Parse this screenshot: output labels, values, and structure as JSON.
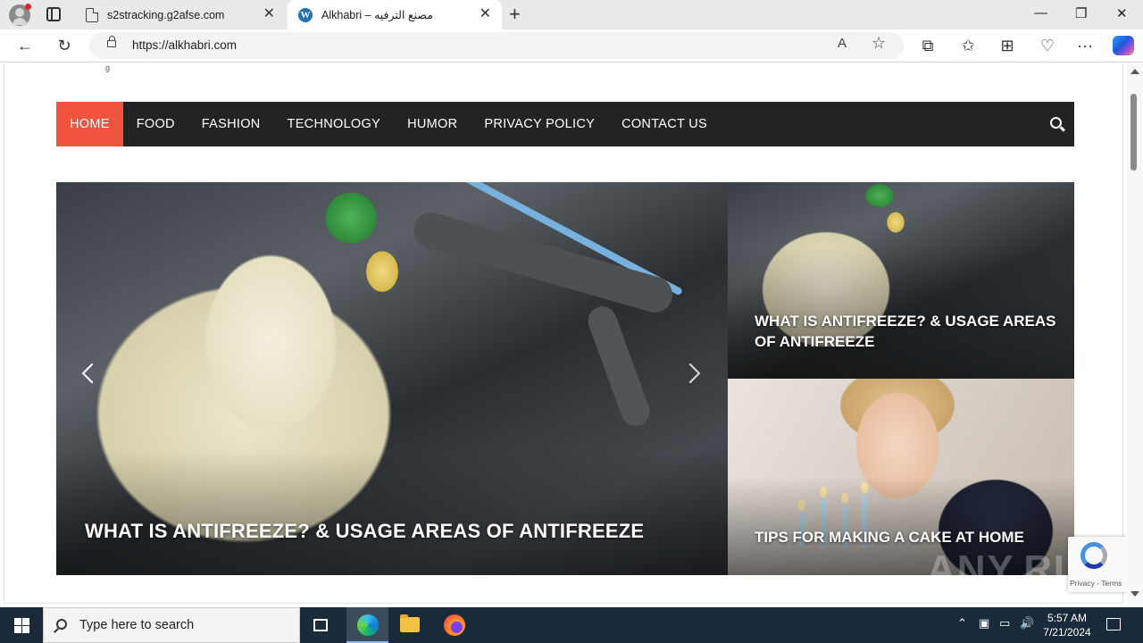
{
  "browser": {
    "tabs": [
      {
        "title": "s2stracking.g2afse.com",
        "close": "✕"
      },
      {
        "title": "Alkhabri – مصنع الترفيه",
        "close": "✕"
      }
    ],
    "new_tab": "+",
    "window_controls": {
      "minimize": "—",
      "restore": "❐",
      "close": "✕"
    },
    "url": "https://alkhabri.com",
    "toolbar_glyphs": {
      "back": "←",
      "reload": "↻",
      "read_aloud": "A",
      "favorite": "☆",
      "more": "···"
    }
  },
  "site": {
    "stray_text": "g",
    "nav": {
      "items": [
        {
          "label": "Home",
          "active": true
        },
        {
          "label": "Food"
        },
        {
          "label": "Fashion"
        },
        {
          "label": "Technology"
        },
        {
          "label": "Humor"
        },
        {
          "label": "Privacy Policy"
        },
        {
          "label": "Contact Us"
        }
      ]
    },
    "slider": {
      "title": "What is Antifreeze? & Usage Areas of Antifreeze"
    },
    "cards": [
      {
        "title": "What is Antifreeze? & Usage Areas of Antifreeze"
      },
      {
        "title": "Tips for Making a Cake at Home"
      }
    ],
    "watermark": "ANY.RUN",
    "recaptcha": {
      "text": "Privacy - Terms"
    }
  },
  "taskbar": {
    "search_placeholder": "Type here to search",
    "time": "5:57 AM",
    "date": "7/21/2024",
    "tray_glyphs": {
      "chevron": "⌃",
      "volume": "🔊"
    }
  }
}
